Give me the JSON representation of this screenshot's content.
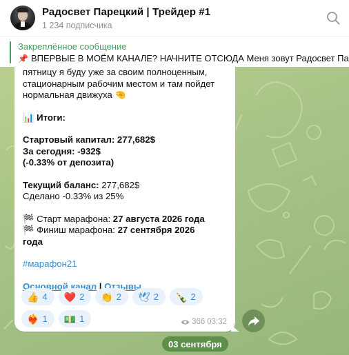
{
  "header": {
    "channel_title": "Радосвет Парецкий | Трейдер #1",
    "subscribers": "1 234 подписчика",
    "search_icon": "search-icon"
  },
  "pinned": {
    "label": "Закреплённое сообщение",
    "pin_icon": "📌",
    "text": "ВПЕРВЫЕ В МОЁМ КАНАЛЕ? НАЧНИТЕ ОТСЮДА  Меня зовут Радосвет Парецкий"
  },
  "message": {
    "intro_line1": "пятницу я буду уже за своим полноценным,",
    "intro_line2": "стационарным рабочим местом и там пойдет",
    "intro_line3": "нормальная движуха",
    "intro_emoji": "🤏",
    "results_icon": "📊",
    "results_title": "Итоги:",
    "start_capital": "Стартовый капитал: 277,682$",
    "today": "За сегодня: -932$",
    "today_pct": "(-0.33% от депозита)",
    "balance_label": "Текущий баланс:",
    "balance_value": " 277,682$",
    "done": "Сделано -0.33% из 25%",
    "flag_icon": "🏁",
    "start_label": " Старт марафона: ",
    "start_date": "27 августа 2026 года",
    "finish_label": " Финиш марафона: ",
    "finish_date_1": "27 сентября 2026",
    "finish_date_2": "года",
    "hashtag": "#марафон21",
    "link_main": "Основной канал",
    "link_sep": " | ",
    "link_reviews": "Отзывы",
    "views": "366",
    "time": "03:32"
  },
  "reactions": [
    {
      "emoji": "👍",
      "count": "4"
    },
    {
      "emoji": "❤️",
      "count": "2"
    },
    {
      "emoji": "👏",
      "count": "2"
    },
    {
      "emoji": "🕊",
      "count": "2"
    },
    {
      "emoji": "🍾",
      "count": "2"
    },
    {
      "emoji": "❤️‍🔥",
      "count": "1"
    },
    {
      "emoji": "💵",
      "count": "1"
    }
  ],
  "date_chip": "03 сентября",
  "colors": {
    "accent_green": "#3fa15a",
    "link_blue": "#3a8fd1",
    "reaction_bg": "#e9f1fa",
    "date_chip_bg": "#5d8f4a"
  }
}
